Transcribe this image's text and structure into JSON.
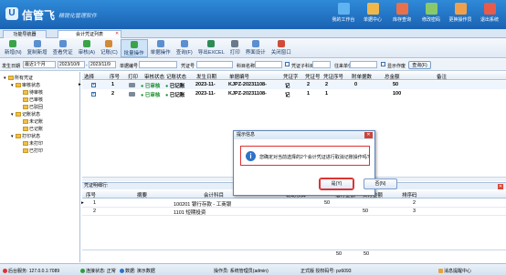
{
  "app": {
    "logo": "U",
    "brand": "信管飞",
    "slogan": "精锐化管理软件"
  },
  "topnav": [
    {
      "label": "我的工作台",
      "icon": "desktop-icon",
      "color": "#5fb3f0"
    },
    {
      "label": "单据中心",
      "icon": "documents-icon",
      "color": "#f0b84a"
    },
    {
      "label": "库存查询",
      "icon": "warehouse-icon",
      "color": "#e8704a"
    },
    {
      "label": "修改密码",
      "icon": "lock-icon",
      "color": "#8ac96a"
    },
    {
      "label": "更换操作员",
      "icon": "user-icon",
      "color": "#f0a04a"
    },
    {
      "label": "退出系统",
      "icon": "exit-icon",
      "color": "#e85a4a"
    }
  ],
  "tabs": [
    {
      "label": "功能导航器"
    },
    {
      "label": "会计凭证列表"
    }
  ],
  "toolbar": [
    {
      "label": "新增(N)",
      "icon": "add-icon",
      "color": "#3aa34a"
    },
    {
      "label": "复制新增",
      "icon": "copy-icon",
      "color": "#5b8fd0"
    },
    {
      "label": "查看凭证",
      "icon": "view-icon",
      "color": "#5b8fd0"
    },
    {
      "label": "审核(A)",
      "icon": "audit-icon",
      "color": "#3aa34a"
    },
    {
      "label": "记账(C)",
      "icon": "ledger-icon",
      "color": "#d08a3a"
    },
    {
      "label": "批量操作",
      "icon": "batch-icon",
      "color": "#3aa34a"
    },
    {
      "label": "单据操作",
      "icon": "doc-ops-icon",
      "color": "#5b8fd0"
    },
    {
      "label": "查询(F)",
      "icon": "search-icon",
      "color": "#5b8fd0"
    },
    {
      "label": "导出EXCEL",
      "icon": "excel-icon",
      "color": "#2e8b57"
    },
    {
      "label": "打印",
      "icon": "print-icon",
      "color": "#6a7a8a"
    },
    {
      "label": "界面设计",
      "icon": "design-icon",
      "color": "#5b8fd0"
    },
    {
      "label": "关闭窗口",
      "icon": "close-window-icon",
      "color": "#d04a3a"
    }
  ],
  "filter": {
    "date_label": "发生日期",
    "date_mode": "最近1个月",
    "date_from": "2023/10/9",
    "date_to": "2023/11/9",
    "docno_label": "单据编号",
    "voucher_label": "凭证号",
    "subject_label": "科目名称",
    "subject_code_label": "凭证子科目",
    "unit_label": "往来单位",
    "show_voided_label": "显示作废",
    "query_label": "查询(F)"
  },
  "tree": [
    {
      "label": "所有凭证",
      "level": 0,
      "toggle": "-"
    },
    {
      "label": "审核状态",
      "level": 1,
      "toggle": "-"
    },
    {
      "label": "待审核",
      "level": 2,
      "toggle": ""
    },
    {
      "label": "已审核",
      "level": 2,
      "toggle": ""
    },
    {
      "label": "已驳回",
      "level": 2,
      "toggle": ""
    },
    {
      "label": "记账状态",
      "level": 1,
      "toggle": "-"
    },
    {
      "label": "未记账",
      "level": 2,
      "toggle": ""
    },
    {
      "label": "已记账",
      "level": 2,
      "toggle": ""
    },
    {
      "label": "打印状态",
      "level": 1,
      "toggle": "-"
    },
    {
      "label": "未打印",
      "level": 2,
      "toggle": ""
    },
    {
      "label": "已打印",
      "level": 2,
      "toggle": ""
    }
  ],
  "grid": {
    "columns": [
      "选择",
      "序号",
      "打印",
      "审核状态",
      "记账状态",
      "发生日期",
      "单据编号",
      "凭证字",
      "凭证号",
      "凭证序号",
      "附单据数",
      "总金额",
      "备注"
    ],
    "rows": [
      {
        "indicator": "▸",
        "seq": "1",
        "audit": "● 已审核",
        "post": "● 已记账",
        "date": "2023-11-",
        "docno": "KJPZ-20231108-",
        "word": "记",
        "vno": "2",
        "vseq": "2",
        "attach": "0",
        "total": "50",
        "note": ""
      },
      {
        "indicator": "",
        "seq": "2",
        "audit": "● 已审核",
        "post": "● 已记账",
        "date": "2023-11-",
        "docno": "KJPZ-20231108-",
        "word": "记",
        "vno": "1",
        "vseq": "1",
        "attach": "",
        "total": "100",
        "note": ""
      }
    ]
  },
  "detail": {
    "title": "凭证明细行:",
    "columns": [
      "序号",
      "摘要",
      "会计科目",
      "辅助核算",
      "借方金额",
      "贷方金额",
      "排序码"
    ],
    "rows": [
      {
        "indicator": "▸",
        "seq": "1",
        "summary": "",
        "account": "100201 银行存款 - 工商银",
        "aux": "",
        "debit": "50",
        "credit": "",
        "sort": "2"
      },
      {
        "indicator": "",
        "seq": "2",
        "summary": "",
        "account": "1101 短期投资",
        "aux": "",
        "debit": "",
        "credit": "50",
        "sort": "3"
      }
    ],
    "totals": {
      "debit": "50",
      "credit": "50"
    }
  },
  "dialog": {
    "title": "提示信息",
    "message": "您确定对当前选择的2个会计凭证进行取消记账操作吗?",
    "yes": "是(Y)",
    "no": "否(N)"
  },
  "status": {
    "server": "后台服务: 127.0.0.1:7089",
    "connection": "连接状态: 正常",
    "data": "数据: 演示数据",
    "operator": "操作员: 系统管理员(admin)",
    "version": "正式版  授权码号: pz6093",
    "messages": "消息提醒中心"
  }
}
